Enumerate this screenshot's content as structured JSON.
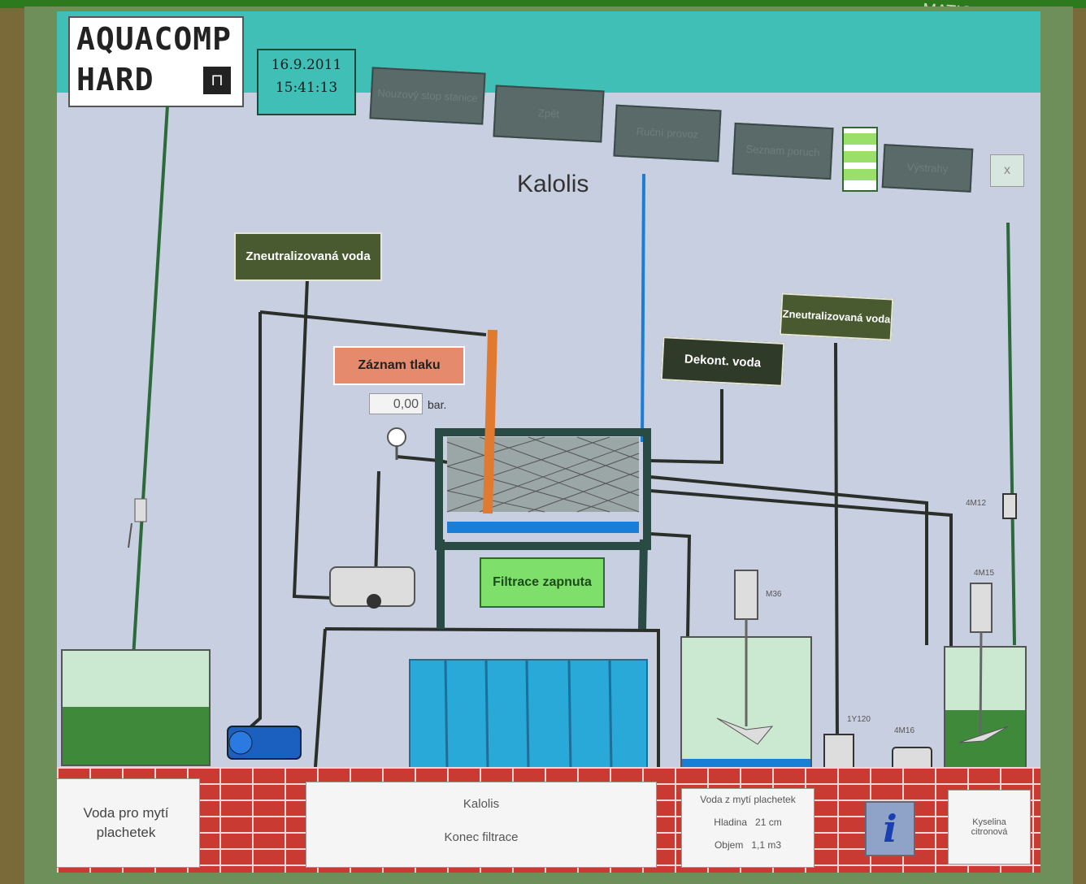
{
  "monitor": {
    "brand_text": "MATIC MULTI PA"
  },
  "header": {
    "logo_line1": "AQUACOMP",
    "logo_line2": "HARD",
    "date": "16.9.2011",
    "time": "15:41:13",
    "nav_buttons": [
      {
        "label": "Nouzový stop stanice"
      },
      {
        "label": "Zpět"
      },
      {
        "label": "Ruční provoz"
      },
      {
        "label": "Seznam poruch"
      },
      {
        "label": "Výstrahy"
      }
    ],
    "close_label": "x"
  },
  "screen_title": "Kalolis",
  "labels": {
    "neutral_water_left": "Zneutralizovaná voda",
    "neutral_water_right": "Zneutralizovaná voda",
    "decont_water": "Dekont. voda",
    "pressure_record_button": "Záznam tlaku",
    "pressure_value": "0,00",
    "pressure_unit": "bar.",
    "filtration_status": "Filtrace zapnuta",
    "mixer_tag_1": "M36",
    "mixer_tag_2": "4M15",
    "valve_tag_1": "4M12",
    "valve_tag_2": "1Y120",
    "pump_tag": "4M16"
  },
  "bottom_panels": {
    "water_for_washing": "Voda pro mytí plachetek",
    "press_title": "Kalolis",
    "press_status": "Konec filtrace",
    "wash_water_title": "Voda z mytí plachetek",
    "level_label": "Hladina",
    "level_value": "21 cm",
    "volume_label": "Objem",
    "volume_value": "1,1 m3",
    "citric_acid": "Kyselina citronová",
    "info_icon": "i"
  },
  "colors": {
    "header_teal": "#3fbfb5",
    "pipe_dark": "#2a2f2a",
    "pipe_green": "#2d6a3a",
    "pipe_blue": "#1b7ed6",
    "pipe_orange": "#e07a30",
    "brick": "#c83a32"
  }
}
